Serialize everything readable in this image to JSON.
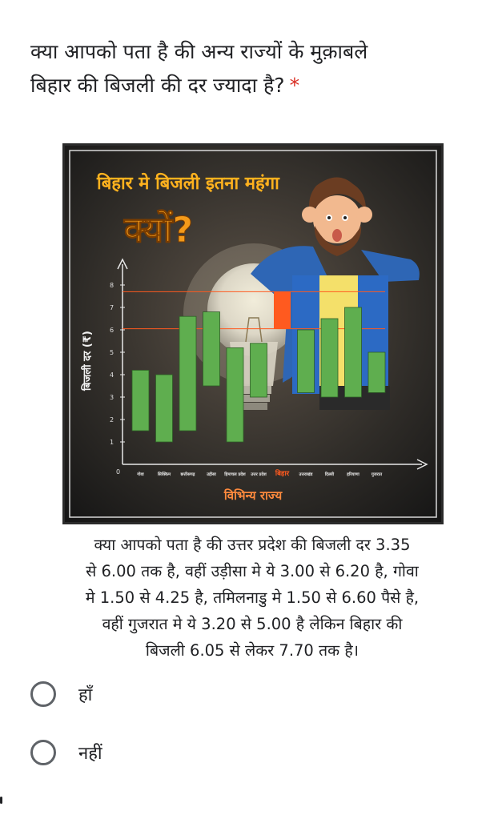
{
  "question": {
    "line1": "क्या आपको पता है की अन्य राज्यों के मुक़ाबले",
    "line2": "बिहार की बिजली की दर ज्यादा है?",
    "required_marker": "*"
  },
  "image": {
    "headline": "बिहार मे बिजली इतना महंगा",
    "big_text": "क्यों?",
    "y_axis_label": "बिजली दर (₹)",
    "y_ticks": [
      "1",
      "2",
      "3",
      "4",
      "5",
      "6",
      "7",
      "8"
    ],
    "origin_label": "0",
    "x_axis_label": "विभिन्य राज्य",
    "state_labels": [
      "गोवा",
      "सिक्किम",
      "छत्तीसगढ़",
      "उड़ीसा",
      "हिमाचल प्रदेश",
      "उत्तर प्रदेश",
      "बिहार",
      "उत्तराखंड",
      "दिल्ली",
      "हरियाणा",
      "गुजरात"
    ],
    "highlight_color": "#ff5a1f",
    "bar_color": "#5fae4f",
    "chart_data": {
      "type": "bar",
      "bars": [
        {
          "low": 1.5,
          "high": 4.2
        },
        {
          "low": 1.0,
          "high": 4.0
        },
        {
          "low": 1.5,
          "high": 6.6
        },
        {
          "low": 3.5,
          "high": 6.8
        },
        {
          "low": 1.0,
          "high": 5.2
        },
        {
          "low": 3.0,
          "high": 5.4
        },
        {
          "low": 6.05,
          "high": 7.7,
          "highlight": true
        },
        {
          "low": 3.2,
          "high": 6.0
        },
        {
          "low": 3.0,
          "high": 6.5
        },
        {
          "low": 3.0,
          "high": 7.0
        },
        {
          "low": 3.2,
          "high": 5.0
        }
      ],
      "ylim": [
        0,
        9
      ]
    }
  },
  "caption": {
    "lines": [
      "क्या आपको पता है की उत्तर प्रदेश की बिजली दर 3.35",
      "से 6.00 तक है, वहीं उड़ीसा मे ये 3.00 से 6.20 है, गोवा",
      "मे 1.50 से 4.25 है, तमिलनाडु मे 1.50 से 6.60 पैसे है,",
      "वहीं गुजरात मे ये 3.20 से 5.00 है लेकिन बिहार की",
      "बिजली 6.05 से लेकर 7.70 तक है।"
    ]
  },
  "options": [
    {
      "label": "हाँ"
    },
    {
      "label": "नहीं"
    }
  ]
}
